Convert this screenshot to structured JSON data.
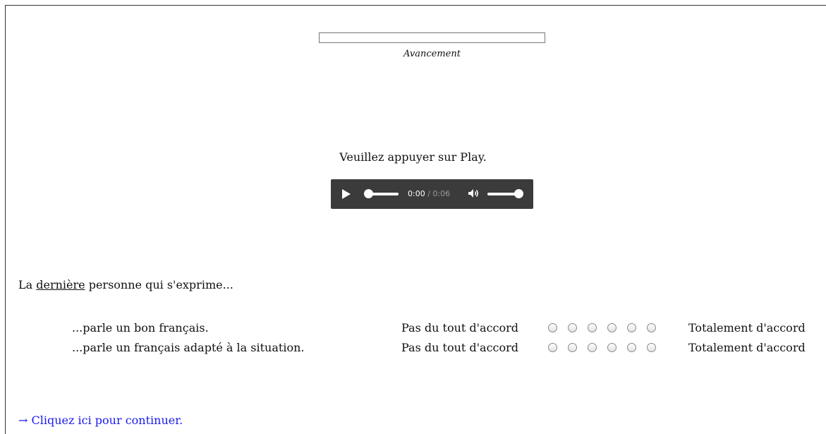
{
  "progress": {
    "label": "Avancement",
    "value_percent": 0,
    "fill_color": "#4a7fd0"
  },
  "instruction": "Veuillez appuyer sur Play.",
  "audio_player": {
    "current_time": "0:00",
    "separator": " / ",
    "duration": "0:06",
    "playback_position": 0,
    "volume_level": 1.0,
    "icons": [
      "play-icon",
      "volume-icon"
    ]
  },
  "question": {
    "prefix": "La ",
    "emphasis": "dernière",
    "suffix": " personne qui s'exprime..."
  },
  "likert": {
    "left_anchor": "Pas du tout d'accord",
    "right_anchor": "Totalement d'accord",
    "option_count": 6,
    "items": [
      {
        "text": "...parle un bon français."
      },
      {
        "text": "...parle un français adapté à la situation."
      }
    ]
  },
  "continue_link": {
    "arrow": "→",
    "label": "Cliquez ici pour continuer."
  },
  "colors": {
    "link": "#1a1aee",
    "player_background": "#3b3b3b"
  }
}
